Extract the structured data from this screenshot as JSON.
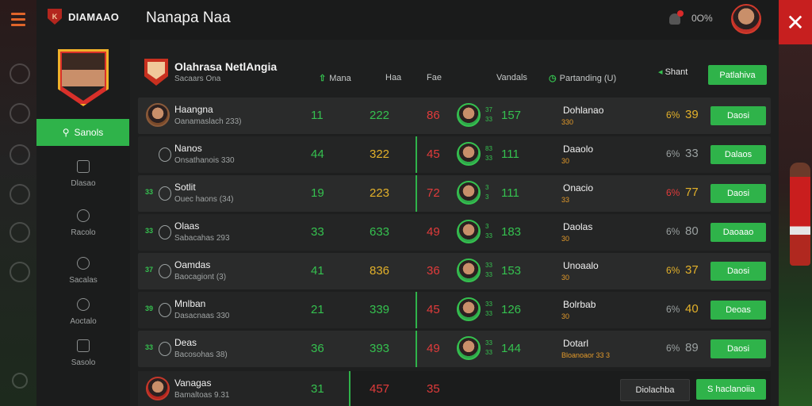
{
  "app": {
    "brand": "DIAMAAO",
    "page_title": "Nanapa Naa",
    "points": "0O%"
  },
  "sidebar": {
    "active": {
      "label": "Sanols"
    },
    "items": [
      {
        "label": "Dlasao",
        "icon": "square-icon"
      },
      {
        "label": "Racolo",
        "icon": "gear-icon"
      },
      {
        "label": "Sacalas",
        "icon": "person-icon"
      },
      {
        "label": "Aoctalo",
        "icon": "person-icon"
      },
      {
        "label": "Sasolo",
        "icon": "calendar-icon"
      }
    ]
  },
  "header": {
    "title": "Olahrasa NetlAngia",
    "subtitle": "Sacaars Ona",
    "cols": {
      "c1": "Mana",
      "c2": "Haa",
      "c3": "Fae",
      "c4": "Vandals",
      "c5": "Partanding (U)"
    },
    "btn_a": "Shant",
    "btn_b": "Patlahiva"
  },
  "rows": [
    {
      "rank": "",
      "name": "Haangna",
      "info": "Oanamaslach 233)",
      "v1": "11",
      "v2": "222",
      "v2_color": "#35c14f",
      "v3": "86",
      "badge_a": "37",
      "badge_b": "33",
      "v4": "157",
      "opp": "Dohlanao",
      "opp_sub": "330",
      "odds1": "6%",
      "odds1_color": "#e3b12a",
      "odds2": "39",
      "odds2_color": "#e3b12a",
      "action": "Daosi"
    },
    {
      "rank": "",
      "name": "Nanos",
      "info": "Onsathanois 330",
      "v1": "44",
      "v2": "322",
      "v2_color": "#e3b12a",
      "v3": "45",
      "badge_a": "83",
      "badge_b": "33",
      "v4": "111",
      "opp": "Daaolo",
      "opp_sub": "30",
      "odds1": "6%",
      "odds1_color": "#9aa0a0",
      "odds2": "33",
      "odds2_color": "#9aa0a0",
      "action": "Dalaos"
    },
    {
      "rank": "33",
      "name": "Sotlit",
      "info": "Ouec haons (34)",
      "v1": "19",
      "v2": "223",
      "v2_color": "#e3b12a",
      "v3": "72",
      "badge_a": "3",
      "badge_b": "3",
      "v4": "111",
      "opp": "Onacio",
      "opp_sub": "33",
      "odds1": "6%",
      "odds1_color": "#e23b3b",
      "odds2": "77",
      "odds2_color": "#e3b12a",
      "action": "Daosi"
    },
    {
      "rank": "33",
      "name": "Olaas",
      "info": "Sabacahas 293",
      "v1": "33",
      "v2": "633",
      "v2_color": "#35c14f",
      "v3": "49",
      "badge_a": "3",
      "badge_b": "33",
      "v4": "183",
      "opp": "Daolas",
      "opp_sub": "30",
      "odds1": "6%",
      "odds1_color": "#9aa0a0",
      "odds2": "80",
      "odds2_color": "#9aa0a0",
      "action": "Daoaao"
    },
    {
      "rank": "37",
      "name": "Oamdas",
      "info": "Baocagiont (3)",
      "v1": "41",
      "v2": "836",
      "v2_color": "#e3b12a",
      "v3": "36",
      "badge_a": "33",
      "badge_b": "33",
      "v4": "153",
      "opp": "Unoaalo",
      "opp_sub": "30",
      "odds1": "6%",
      "odds1_color": "#e3b12a",
      "odds2": "37",
      "odds2_color": "#e3b12a",
      "action": "Daosi"
    },
    {
      "rank": "39",
      "name": "Mnlban",
      "info": "Dasacnaas 330",
      "v1": "21",
      "v2": "339",
      "v2_color": "#35c14f",
      "v3": "45",
      "badge_a": "33",
      "badge_b": "33",
      "v4": "126",
      "opp": "Bolrbab",
      "opp_sub": "30",
      "odds1": "6%",
      "odds1_color": "#9aa0a0",
      "odds2": "40",
      "odds2_color": "#e3b12a",
      "action": "Deoas"
    },
    {
      "rank": "33",
      "name": "Deas",
      "info": "Bacosohas 38)",
      "v1": "36",
      "v2": "393",
      "v2_color": "#35c14f",
      "v3": "49",
      "badge_a": "33",
      "badge_b": "33",
      "v4": "144",
      "opp": "Dotarl",
      "opp_sub": "Bloanoaor 33 3",
      "odds1": "6%",
      "odds1_color": "#9aa0a0",
      "odds2": "89",
      "odds2_color": "#9aa0a0",
      "action": "Daosi"
    }
  ],
  "footer": {
    "name": "Vanagas",
    "info": "Bamaltoas 9.31",
    "v1": "31",
    "v2": "457",
    "v3": "35",
    "btn_secondary": "Diolachba",
    "btn_primary": "S haclanoiia"
  },
  "colors": {
    "accent": "#2fb34a",
    "danger": "#e23b3b",
    "warning": "#e3b12a",
    "brand": "#c7301f"
  }
}
